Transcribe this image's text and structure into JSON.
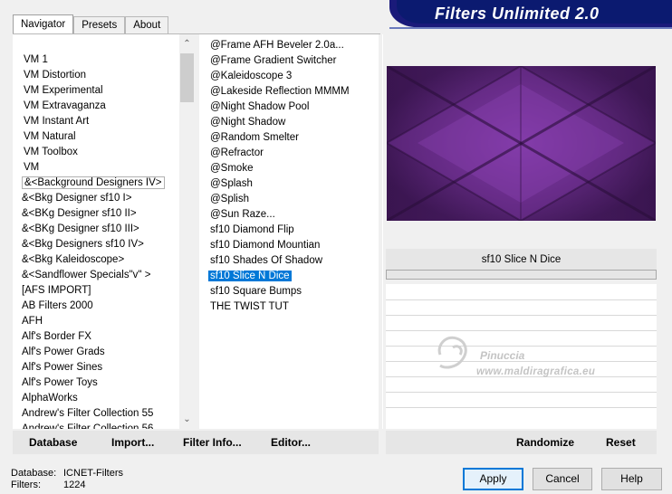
{
  "tabs": [
    "Navigator",
    "Presets",
    "About"
  ],
  "banner_title": "Filters Unlimited 2.0",
  "categories": [
    "VM 1",
    "VM Distortion",
    "VM Experimental",
    "VM Extravaganza",
    "VM Instant Art",
    "VM Natural",
    "VM Toolbox",
    "VM",
    "&<Background Designers IV>",
    "&<Bkg Designer sf10 I>",
    "&<BKg Designer sf10 II>",
    "&<BKg Designer sf10 III>",
    "&<Bkg Designers sf10 IV>",
    "&<Bkg Kaleidoscope>",
    "&<Sandflower Specials\"v\" >",
    "[AFS IMPORT]",
    "AB Filters 2000",
    "AFH",
    "Alf's Border FX",
    "Alf's Power Grads",
    "Alf's Power Sines",
    "Alf's Power Toys",
    "AlphaWorks",
    "Andrew's Filter Collection 55",
    "Andrew's Filter Collection 56"
  ],
  "filters": [
    "@Frame AFH Beveler 2.0a...",
    "@Frame Gradient Switcher",
    "@Kaleidoscope 3",
    "@Lakeside Reflection MMMM",
    "@Night Shadow Pool",
    "@Night Shadow",
    "@Random Smelter",
    "@Refractor",
    "@Smoke",
    "@Splash",
    "@Splish",
    "@Sun Raze...",
    "sf10 Diamond Flip",
    "sf10 Diamond Mountian",
    "sf10 Shades Of Shadow",
    "sf10 Slice N Dice",
    "sf10 Square Bumps",
    "THE TWIST TUT"
  ],
  "selected_filter": "sf10 Slice N Dice",
  "selected_filter_name": "sf10 Slice N Dice",
  "toolbar": {
    "database": "Database",
    "import": "Import...",
    "filter_info": "Filter Info...",
    "editor": "Editor...",
    "randomize": "Randomize",
    "reset": "Reset"
  },
  "status": {
    "database_label": "Database:",
    "database_value": "ICNET-Filters",
    "filters_label": "Filters:",
    "filters_value": "1224"
  },
  "buttons": {
    "apply": "Apply",
    "cancel": "Cancel",
    "help": "Help"
  },
  "watermark": {
    "name": "Pinuccia",
    "url": "www.maldiragrafica.eu"
  },
  "colors": {
    "selection": "#0078d7",
    "banner": "#0b1a70",
    "preview_dark": "#3a1550",
    "preview_light": "#8a3fb0"
  }
}
